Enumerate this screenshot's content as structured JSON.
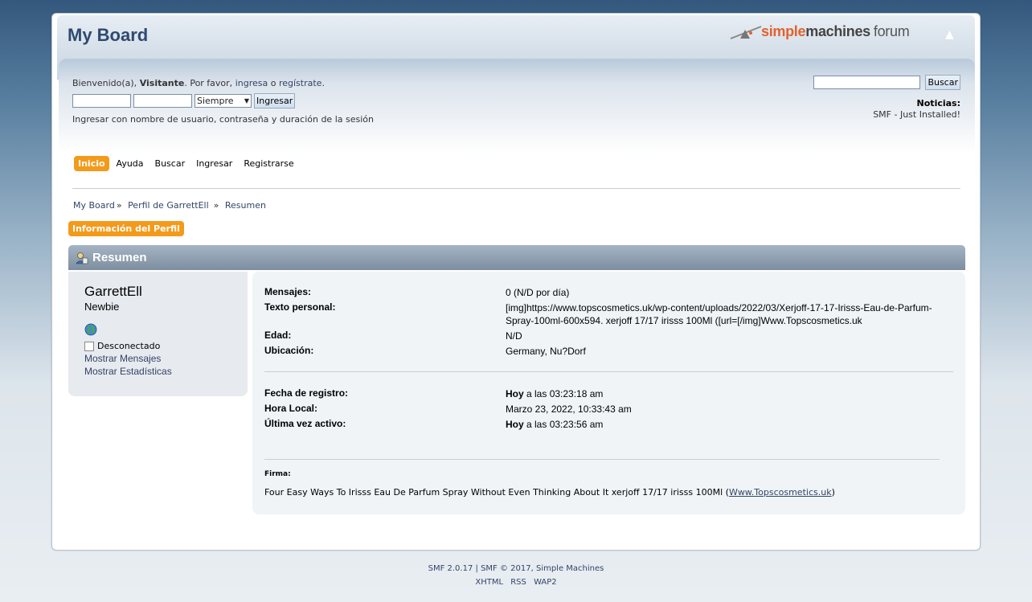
{
  "header": {
    "forum_title": "My Board",
    "logo": {
      "simple": "simple",
      "machines": "machines",
      "forum": "forum"
    },
    "upshrink_icon": "chevron-up-icon"
  },
  "user_section": {
    "greeting_prefix": "Bienvenido(a), ",
    "greeting_user": "Visitante",
    "greeting_mid": ". Por favor, ",
    "login_link": "ingresa",
    "greeting_or": " o ",
    "register_link": "regístrate",
    "greeting_end": ".",
    "username_value": "",
    "password_value": "",
    "duration_selected": "Siempre",
    "login_button": "Ingresar",
    "login_hint": "Ingresar con nombre de usuario, contraseña y duración de la sesión"
  },
  "search": {
    "value": "",
    "button": "Buscar"
  },
  "news": {
    "title": "Noticias:",
    "text": "SMF - Just Installed!"
  },
  "menu": [
    {
      "label": "Inicio",
      "active": true
    },
    {
      "label": "Ayuda"
    },
    {
      "label": "Buscar"
    },
    {
      "label": "Ingresar"
    },
    {
      "label": "Registrarse"
    }
  ],
  "breadcrumb": {
    "items": [
      "My Board",
      "Perfil de GarrettEll",
      "Resumen"
    ],
    "separator": "»"
  },
  "profile_tab": "Información del Perfil",
  "category": {
    "title": "Resumen",
    "icon": "profile-icon"
  },
  "member": {
    "name": "GarrettEll",
    "title": "Newbie",
    "website_icon": "globe-icon",
    "status": "Desconectado",
    "show_posts": "Mostrar Mensajes",
    "show_stats": "Mostrar Estadísticas"
  },
  "details": {
    "posts": {
      "label": "Mensajes:",
      "value": "0 (N/D por día)"
    },
    "personal_text": {
      "label": "Texto personal:",
      "value": "[img]https://www.topscosmetics.uk/wp-content/uploads/2022/03/Xerjoff-17-17-Irisss-Eau-de-Parfum-Spray-100ml-600x594. xerjoff 17/17 irisss 100Ml ([url=[/img]Www.Topscosmetics.uk"
    },
    "age": {
      "label": "Edad:",
      "value": "N/D"
    },
    "location": {
      "label": "Ubicación:",
      "value": "Germany, Nu?Dorf"
    },
    "registered": {
      "label": "Fecha de registro:",
      "value_bold": "Hoy",
      "value_rest": " a las 03:23:18 am"
    },
    "local_time": {
      "label": "Hora Local:",
      "value": "Marzo 23, 2022, 10:33:43 am"
    },
    "last_active": {
      "label": "Última vez activo:",
      "value_bold": "Hoy",
      "value_rest": " a las 03:23:56 am"
    }
  },
  "signature": {
    "title": "Firma:",
    "text": "Four Easy Ways To Irisss Eau De Parfum Spray Without Even Thinking About It xerjoff 17/17 irisss 100Ml (",
    "link": "Www.Topscosmetics.uk",
    "text_end": ")"
  },
  "footer": {
    "smf_version": "SMF 2.0.17",
    "sep": " | ",
    "copyright": "SMF © 2017",
    "comma": ", ",
    "simple_machines": "Simple Machines",
    "links": [
      "XHTML",
      "RSS",
      "WAP2"
    ]
  },
  "colors": {
    "accent": "#f49a1a",
    "title": "#2e4a70",
    "link": "#334466"
  }
}
